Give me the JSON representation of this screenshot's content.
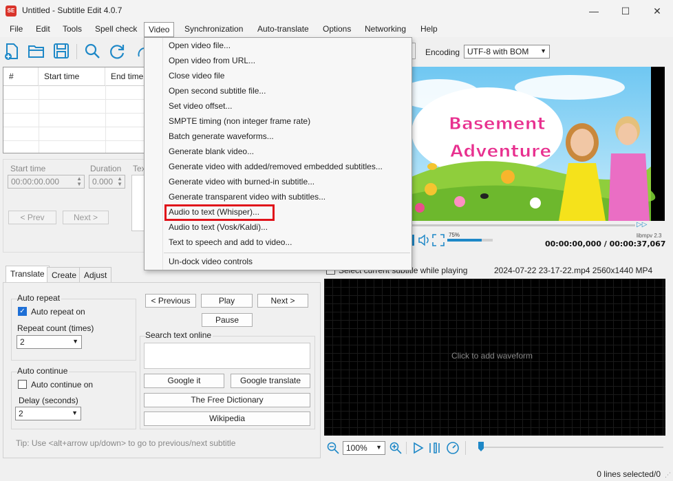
{
  "window": {
    "title": "Untitled - Subtitle Edit 4.0.7",
    "app_icon": "SE",
    "controls": [
      "—",
      "☐",
      "✕"
    ]
  },
  "menubar": {
    "items": [
      "File",
      "Edit",
      "Tools",
      "Spell check",
      "Video",
      "Synchronization",
      "Auto-translate",
      "Options",
      "Networking",
      "Help"
    ],
    "active": "Video"
  },
  "toolbar": {
    "encoding_label": "Encoding",
    "encoding_value": "UTF-8 with BOM",
    "icons": [
      "new-file-icon",
      "open-folder-icon",
      "save-icon",
      "search-icon",
      "refresh-icon"
    ]
  },
  "grid": {
    "columns": [
      "#",
      "Start time",
      "End time"
    ]
  },
  "edit": {
    "start_time_label": "Start time",
    "start_time_value": "00:00:00.000",
    "duration_label": "Duration",
    "duration_value": "0.000",
    "text_label": "Tex",
    "prev_button": "< Prev",
    "next_button": "Next >"
  },
  "video_menu": {
    "items": [
      "Open video file...",
      "Open video from URL...",
      "Close video file",
      "Open second subtitle file...",
      "Set video offset...",
      "SMPTE timing (non integer frame rate)",
      "Batch generate waveforms...",
      "Generate blank video...",
      "Generate video with added/removed embedded subtitles...",
      "Generate video with burned-in subtitle...",
      "Generate transparent video with subtitles...",
      "Audio to text (Whisper)...",
      "Audio to text (Vosk/Kaldi)...",
      "Text to speech and add to video..."
    ],
    "undock": "Un-dock video controls",
    "highlighted": "Audio to text (Whisper)..."
  },
  "video": {
    "title_line1": "Basement",
    "title_line2": "Adventure",
    "volume_percent": "75%",
    "volume_level": 0.75,
    "engine": "libmpv 2.3",
    "time_current": "00:00:00,000",
    "time_separator": "/",
    "time_total": "00:00:37,067",
    "select_current_label": "Select current subtitle while playing",
    "file_info": "2024-07-22 23-17-22.mp4 2560x1440 MP4"
  },
  "tabs": {
    "items": [
      "Translate",
      "Create",
      "Adjust"
    ],
    "selected": "Translate"
  },
  "translate": {
    "auto_repeat_group": "Auto repeat",
    "auto_repeat_on": "Auto repeat on",
    "auto_repeat_checked": true,
    "repeat_count_label": "Repeat count (times)",
    "repeat_count_value": "2",
    "auto_continue_group": "Auto continue",
    "auto_continue_on": "Auto continue on",
    "auto_continue_checked": false,
    "delay_label": "Delay (seconds)",
    "delay_value": "2",
    "previous_button": "< Previous",
    "play_button": "Play",
    "next_button": "Next >",
    "pause_button": "Pause",
    "search_online_label": "Search text online",
    "google_it": "Google it",
    "google_translate": "Google translate",
    "free_dictionary": "The Free Dictionary",
    "wikipedia": "Wikipedia",
    "tip": "Tip: Use <alt+arrow up/down> to go to previous/next subtitle"
  },
  "waveform": {
    "placeholder": "Click to add waveform",
    "zoom_value": "100%"
  },
  "status": {
    "lines_selected": "0 lines selected/0"
  },
  "colors": {
    "accent": "#1e88c7",
    "highlight_box": "#e0121a",
    "title_pink": "#e8308f"
  }
}
